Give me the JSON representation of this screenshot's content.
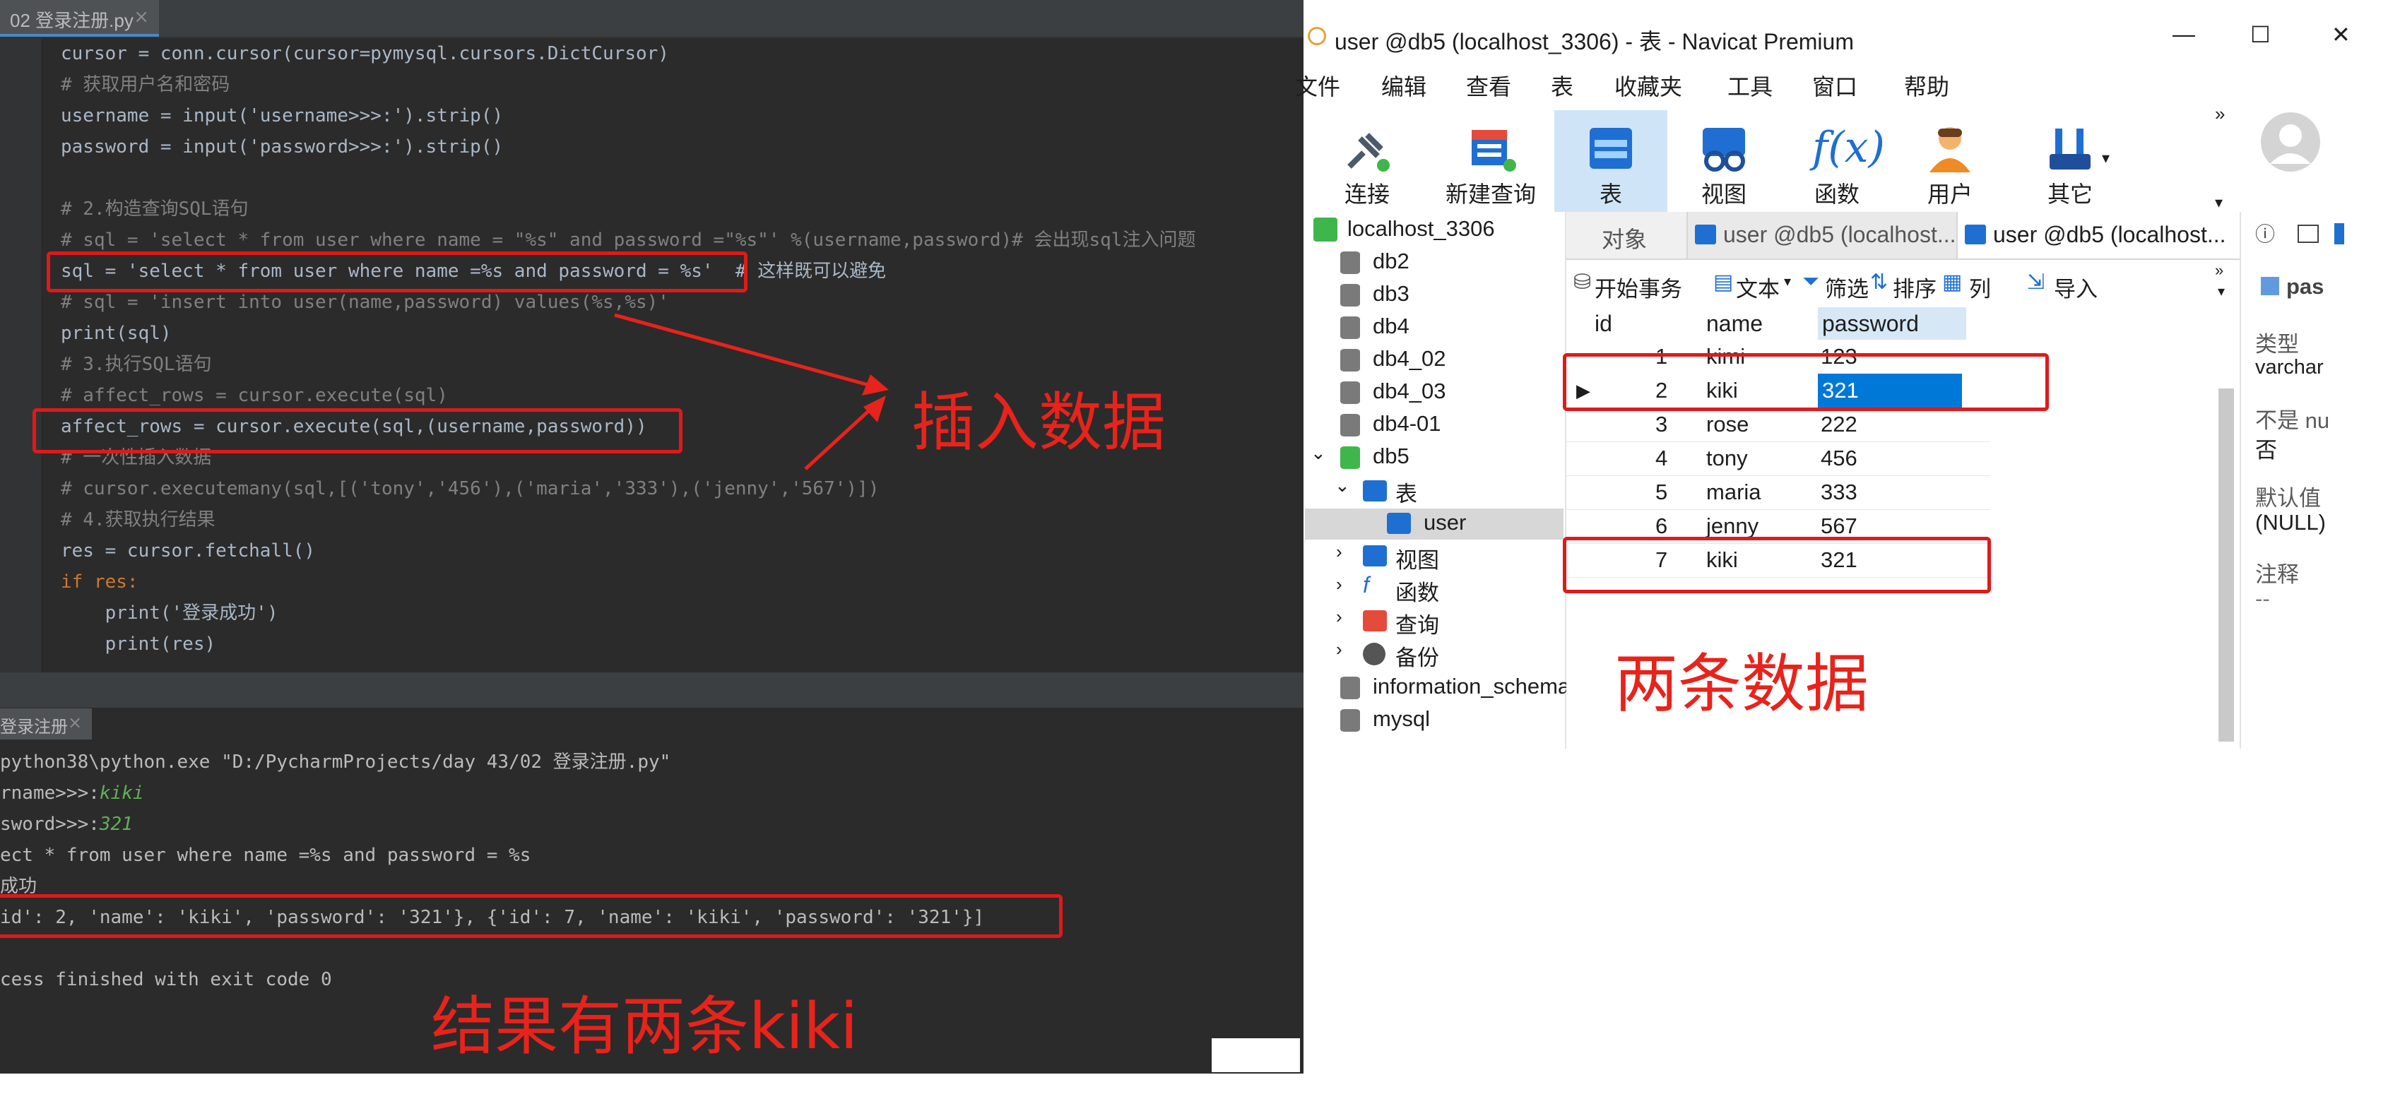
{
  "ide": {
    "tab_title": "02 登录注册.py",
    "tab_close": "×",
    "code_lines": [
      "cursor = conn.cursor(cursor=pymysql.cursors.DictCursor)",
      "# 获取用户名和密码",
      "username = input('username>>>:').strip()",
      "password = input('password>>>:').strip()",
      "",
      "# 2.构造查询SQL语句",
      "# sql = 'select * from user where name = \"%s\" and password =\"%s\"' %(username,password)# 会出现sql注入问题",
      "sql = 'select * from user where name =%s and password = %s'  # 这样既可以避免",
      "# sql = 'insert into user(name,password) values(%s,%s)'",
      "print(sql)",
      "# 3.执行SQL语句",
      "# affect_rows = cursor.execute(sql)",
      "affect_rows = cursor.execute(sql,(username,password))",
      "# 一次性插入数据",
      "# cursor.executemany(sql,[('tony','456'),('maria','333'),('jenny','567')])",
      "# 4.获取执行结果",
      "res = cursor.fetchall()",
      "if res:",
      "    print('登录成功')",
      "    print(res)"
    ],
    "run_tab": "登录注册",
    "run_tab_close": "×",
    "console": {
      "cmd": "python38\\python.exe \"D:/PycharmProjects/day 43/02 登录注册.py\"",
      "prompt_user": "rname>>>:",
      "input_user": "kiki",
      "prompt_pass": "sword>>>:",
      "input_pass": "321",
      "sql_echo": "ect * from user where name =%s and password = %s",
      "success": "成功",
      "result": "id': 2, 'name': 'kiki', 'password': '321'}, {'id': 7, 'name': 'kiki', 'password': '321'}]",
      "finished": "cess finished with exit code 0"
    }
  },
  "annotations": {
    "insert": "插入数据",
    "two_rows": "两条数据",
    "result": "结果有两条kiki"
  },
  "navicat": {
    "title": "user @db5 (localhost_3306) - 表 - Navicat Premium",
    "window_controls": [
      "—",
      "☐",
      "✕"
    ],
    "menu": [
      "文件",
      "编辑",
      "查看",
      "表",
      "收藏夹",
      "工具",
      "窗口",
      "帮助"
    ],
    "toolbar": [
      "连接",
      "新建查询",
      "表",
      "视图",
      "函数",
      "用户",
      "其它"
    ],
    "tree": {
      "connection": "localhost_3306",
      "dbs_top": [
        "db2",
        "db3",
        "db4",
        "db4_02",
        "db4_03",
        "db4-01"
      ],
      "db5": "db5",
      "tables_node": "表",
      "user_table": "user",
      "subnodes": [
        "视图",
        "函数",
        "查询",
        "备份"
      ],
      "dbs_bottom": [
        "information_schema",
        "mysql"
      ]
    },
    "tabs": [
      "对象",
      "user @db5 (localhost...",
      "user @db5 (localhost..."
    ],
    "obj_toolbar": [
      "开始事务",
      "文本",
      "筛选",
      "排序",
      "列",
      "导入"
    ],
    "columns": [
      "id",
      "name",
      "password"
    ],
    "rows": [
      [
        "1",
        "kimi",
        "123"
      ],
      [
        "2",
        "kiki",
        "321"
      ],
      [
        "3",
        "rose",
        "222"
      ],
      [
        "4",
        "tony",
        "456"
      ],
      [
        "5",
        "maria",
        "333"
      ],
      [
        "6",
        "jenny",
        "567"
      ],
      [
        "7",
        "kiki",
        "321"
      ]
    ],
    "props": {
      "field": "pas",
      "type_label": "类型",
      "type_value": "varchar",
      "notnull_label": "不是 nu",
      "notnull_value": "否",
      "default_label": "默认值",
      "default_value": "(NULL)",
      "comment_label": "注释",
      "comment_value": "--"
    }
  }
}
